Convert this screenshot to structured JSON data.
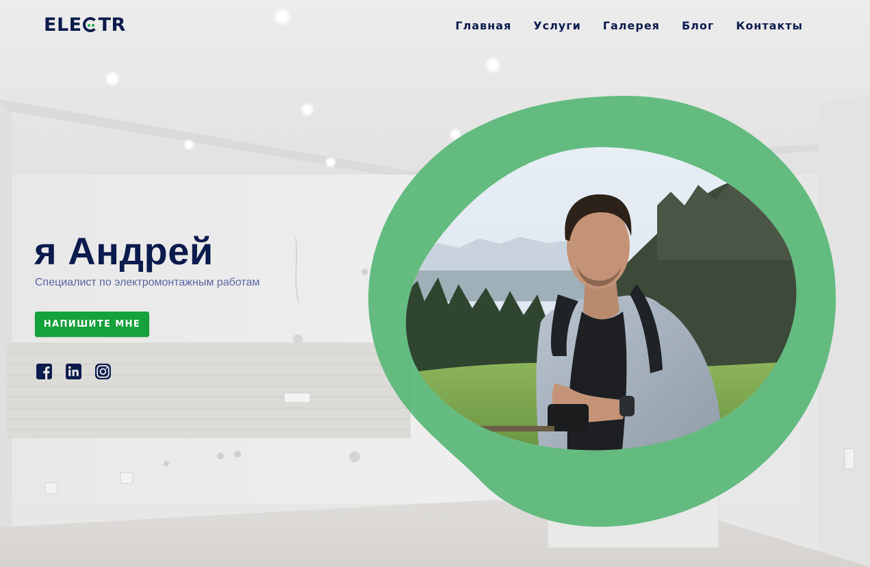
{
  "brand": {
    "logo_prefix": "ELE",
    "logo_suffix": "TR",
    "accent_color": "#23b14d",
    "navy_color": "#0b1b4d"
  },
  "nav": {
    "items": [
      {
        "label": "Главная"
      },
      {
        "label": "Услуги"
      },
      {
        "label": "Галерея"
      },
      {
        "label": "Блог"
      },
      {
        "label": "Контакты"
      }
    ]
  },
  "hero": {
    "title": "я Андрей",
    "subtitle": "Специалист по электромонтажным работам",
    "cta_label": "НАПИШИТЕ МНЕ",
    "cta_color": "#15a13b"
  },
  "socials": [
    {
      "icon": "facebook-icon"
    },
    {
      "icon": "linkedin-icon"
    },
    {
      "icon": "instagram-icon"
    }
  ],
  "photo": {
    "frame_color": "#5cb87a"
  }
}
